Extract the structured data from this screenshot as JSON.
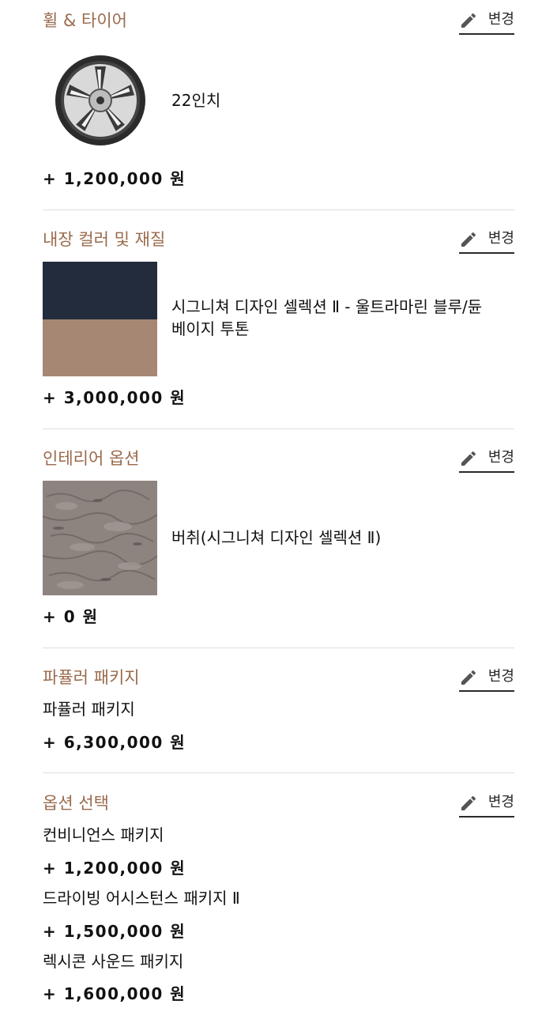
{
  "edit_label": "변경",
  "colors": {
    "accent": "#9a6a4c",
    "navy": "#232c3d",
    "beige": "#a68773"
  },
  "sections": {
    "wheels": {
      "title": "휠 & 타이어",
      "option": "22인치",
      "price": "+ 1,200,000 원",
      "icon": "wheel-image"
    },
    "interior_color": {
      "title": "내장 컬러 및 재질",
      "option_line1": "시그니쳐 디자인 셀렉션 Ⅱ - 울트라마린 블루/듄",
      "option_line2": "베이지 투톤",
      "price": "+ 3,000,000 원",
      "icon": "two-tone-swatch"
    },
    "interior_option": {
      "title": "인테리어 옵션",
      "option": "버취(시그니쳐 디자인 셀렉션 Ⅱ)",
      "price": "+ 0 원",
      "icon": "birch-texture-swatch"
    },
    "package": {
      "title": "파퓰러 패키지",
      "item": "파퓰러 패키지",
      "price": "+ 6,300,000 원"
    },
    "options": {
      "title": "옵션 선택",
      "items": [
        {
          "name": "컨비니언스 패키지",
          "price": "+ 1,200,000 원"
        },
        {
          "name": "드라이빙 어시스턴스 패키지 Ⅱ",
          "price": "+ 1,500,000 원"
        },
        {
          "name": "렉시콘 사운드 패키지",
          "price": "+ 1,600,000 원"
        }
      ]
    }
  }
}
